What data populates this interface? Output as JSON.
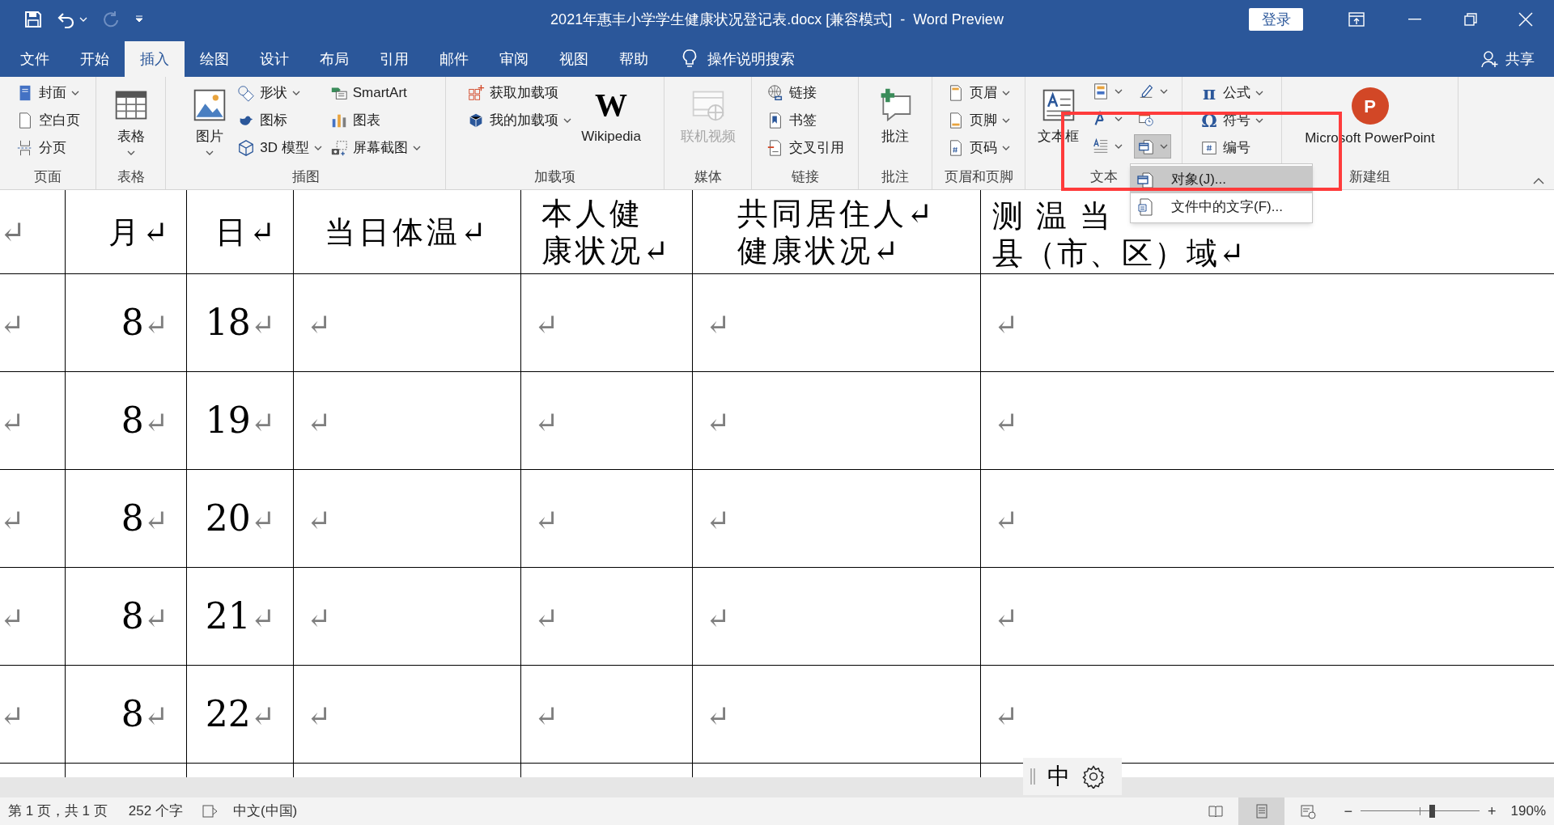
{
  "window": {
    "title": "2021年惠丰小学学生健康状况登记表.docx [兼容模式]  -  Word Preview",
    "login_button": "登录"
  },
  "ribbon_tabs": [
    {
      "label": "文件",
      "selected": false
    },
    {
      "label": "开始",
      "selected": false
    },
    {
      "label": "插入",
      "selected": true
    },
    {
      "label": "绘图",
      "selected": false
    },
    {
      "label": "设计",
      "selected": false
    },
    {
      "label": "布局",
      "selected": false
    },
    {
      "label": "引用",
      "selected": false
    },
    {
      "label": "邮件",
      "selected": false
    },
    {
      "label": "审阅",
      "selected": false
    },
    {
      "label": "视图",
      "selected": false
    },
    {
      "label": "帮助",
      "selected": false
    }
  ],
  "tell_me": "操作说明搜索",
  "share": "共享",
  "ribbon_groups": [
    {
      "label": "页面",
      "columns": [
        [
          {
            "kind": "small",
            "label": "封面",
            "dropdown": true
          },
          {
            "kind": "small",
            "label": "空白页",
            "dropdown": false
          },
          {
            "kind": "small",
            "label": "分页",
            "dropdown": false
          }
        ]
      ]
    },
    {
      "label": "表格",
      "columns": [
        [
          {
            "kind": "large",
            "label": "表格",
            "dropdown": true
          }
        ]
      ]
    },
    {
      "label": "插图",
      "columns": [
        [
          {
            "kind": "large",
            "label": "图片",
            "dropdown": true
          }
        ],
        [
          {
            "kind": "small",
            "label": "形状",
            "dropdown": true
          },
          {
            "kind": "small",
            "label": "图标",
            "dropdown": false
          },
          {
            "kind": "small",
            "label": "3D 模型",
            "dropdown": true
          }
        ],
        [
          {
            "kind": "small",
            "label": "SmartArt",
            "dropdown": false
          },
          {
            "kind": "small",
            "label": "图表",
            "dropdown": false
          },
          {
            "kind": "small",
            "label": "屏幕截图",
            "dropdown": true
          }
        ]
      ]
    },
    {
      "label": "加载项",
      "columns": [
        [
          {
            "kind": "small",
            "label": "获取加载项",
            "dropdown": false
          },
          {
            "kind": "small",
            "label": "我的加载项",
            "dropdown": true
          }
        ],
        [
          {
            "kind": "large",
            "label": "Wikipedia",
            "dropdown": false,
            "glyph": "W"
          }
        ]
      ]
    },
    {
      "label": "媒体",
      "columns": [
        [
          {
            "kind": "large",
            "label": "联机视频",
            "dropdown": false,
            "disabled": true
          }
        ]
      ]
    },
    {
      "label": "链接",
      "columns": [
        [
          {
            "kind": "small",
            "label": "链接",
            "dropdown": false
          },
          {
            "kind": "small",
            "label": "书签",
            "dropdown": false
          },
          {
            "kind": "small",
            "label": "交叉引用",
            "dropdown": false
          }
        ]
      ]
    },
    {
      "label": "批注",
      "columns": [
        [
          {
            "kind": "large",
            "label": "批注",
            "dropdown": false
          }
        ]
      ]
    },
    {
      "label": "页眉和页脚",
      "columns": [
        [
          {
            "kind": "small",
            "label": "页眉",
            "dropdown": true
          },
          {
            "kind": "small",
            "label": "页脚",
            "dropdown": true
          },
          {
            "kind": "small",
            "label": "页码",
            "dropdown": true
          }
        ]
      ]
    },
    {
      "label": "文本",
      "columns": [
        [
          {
            "kind": "large",
            "label": "文本框",
            "dropdown": false
          }
        ],
        [
          {
            "kind": "icon",
            "dropdown": true
          },
          {
            "kind": "icon",
            "dropdown": true
          },
          {
            "kind": "icon",
            "dropdown": true
          }
        ],
        [
          {
            "kind": "icon",
            "dropdown": true
          },
          {
            "kind": "icon",
            "dropdown": false
          },
          {
            "kind": "icon",
            "dropdown": true,
            "pressed": true
          }
        ]
      ]
    },
    {
      "columns": [
        [
          {
            "kind": "small",
            "label": "公式",
            "dropdown": true,
            "glyph": "π"
          },
          {
            "kind": "small",
            "label": "符号",
            "dropdown": true,
            "glyph": "Ω"
          },
          {
            "kind": "small",
            "label": "编号",
            "dropdown": false
          }
        ]
      ]
    },
    {
      "label": "新建组",
      "columns": [
        [
          {
            "kind": "large",
            "label": "Microsoft PowerPoint",
            "dropdown": false,
            "glyph": "P"
          }
        ]
      ]
    }
  ],
  "object_menu": [
    {
      "label": "对象(J)...",
      "highlighted": true
    },
    {
      "label": "文件中的文字(F)...",
      "highlighted": false
    }
  ],
  "table": {
    "header": [
      {
        "lines": [
          "↵"
        ]
      },
      {
        "lines": [
          "月↵"
        ]
      },
      {
        "lines": [
          "日↵"
        ]
      },
      {
        "lines": [
          "当日体温↵"
        ]
      },
      {
        "lines": [
          "本人健",
          "康状况↵"
        ]
      },
      {
        "lines": [
          "共同居住人↵",
          "健康状况↵"
        ]
      },
      {
        "lines": [
          "测 温 当",
          "县（市、区）域↵"
        ]
      }
    ],
    "rows": [
      [
        {
          "end": "↵"
        },
        {
          "text": "8",
          "end": "↵"
        },
        {
          "text": "18",
          "end": "↵"
        },
        {
          "end": "↵"
        },
        {
          "end": "↵"
        },
        {
          "end": "↵"
        },
        {
          "end": "↵"
        }
      ],
      [
        {
          "end": "↵"
        },
        {
          "text": "8",
          "end": "↵"
        },
        {
          "text": "19",
          "end": "↵"
        },
        {
          "end": "↵"
        },
        {
          "end": "↵"
        },
        {
          "end": "↵"
        },
        {
          "end": "↵"
        }
      ],
      [
        {
          "end": "↵"
        },
        {
          "text": "8",
          "end": "↵"
        },
        {
          "text": "20",
          "end": "↵"
        },
        {
          "end": "↵"
        },
        {
          "end": "↵"
        },
        {
          "end": "↵"
        },
        {
          "end": "↵"
        }
      ],
      [
        {
          "end": "↵"
        },
        {
          "text": "8",
          "end": "↵"
        },
        {
          "text": "21",
          "end": "↵"
        },
        {
          "end": "↵"
        },
        {
          "end": "↵"
        },
        {
          "end": "↵"
        },
        {
          "end": "↵"
        }
      ],
      [
        {
          "end": "↵"
        },
        {
          "text": "8",
          "end": "↵"
        },
        {
          "text": "22",
          "end": "↵"
        },
        {
          "end": "↵"
        },
        {
          "end": "↵"
        },
        {
          "end": "↵"
        },
        {
          "end": "↵"
        }
      ]
    ]
  },
  "ime_toolbar": {
    "mode": "中"
  },
  "status_bar": {
    "page": "第 1 页，共 1 页",
    "words": "252 个字",
    "language": "中文(中国)",
    "views": [
      {
        "selected": false
      },
      {
        "selected": true
      },
      {
        "selected": false
      }
    ],
    "zoom_minus": "−",
    "zoom_plus": "+",
    "zoom": {
      "level": 0.6
    },
    "zoom_text": "190%"
  }
}
